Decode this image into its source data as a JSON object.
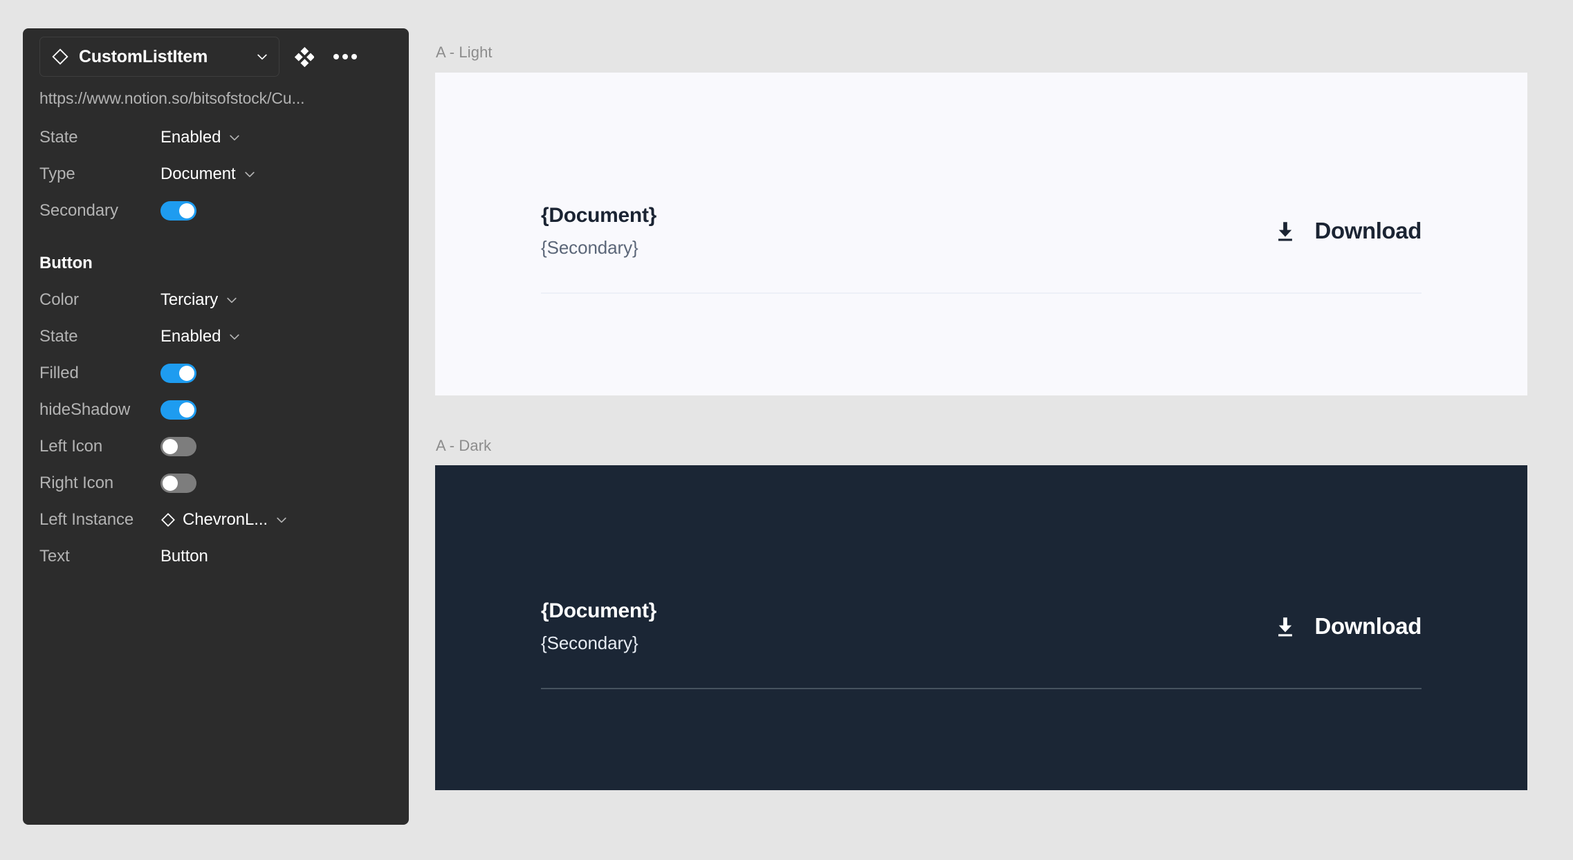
{
  "panel": {
    "component_name": "CustomListItem",
    "url": "https://www.notion.so/bitsofstock/Cu...",
    "icons": {
      "component": "diamond-icon",
      "dropdown": "chevron-down-icon",
      "swap": "four-diamond-icon",
      "more": "more-options-icon"
    },
    "properties": [
      {
        "label": "State",
        "type": "select",
        "value": "Enabled"
      },
      {
        "label": "Type",
        "type": "select",
        "value": "Document"
      },
      {
        "label": "Secondary",
        "type": "toggle",
        "value": "on"
      }
    ],
    "button_section": {
      "title": "Button",
      "properties": [
        {
          "label": "Color",
          "type": "select",
          "value": "Terciary"
        },
        {
          "label": "State",
          "type": "select",
          "value": "Enabled"
        },
        {
          "label": "Filled",
          "type": "toggle",
          "value": "on"
        },
        {
          "label": "hideShadow",
          "type": "toggle",
          "value": "on"
        },
        {
          "label": "Left Icon",
          "type": "toggle",
          "value": "off"
        },
        {
          "label": "Right Icon",
          "type": "toggle",
          "value": "off"
        },
        {
          "label": "Left Instance",
          "type": "instance",
          "value": "ChevronL..."
        },
        {
          "label": "Text",
          "type": "text",
          "value": "Button"
        }
      ]
    }
  },
  "canvas": {
    "frames": [
      {
        "label": "A - Light",
        "theme": "light",
        "background": "#f9f9fd",
        "title": "{Document}",
        "subtitle": "{Secondary}",
        "button_label": "Download",
        "button_icon": "download-icon"
      },
      {
        "label": "A - Dark",
        "theme": "dark",
        "background": "#1b2635",
        "title": "{Document}",
        "subtitle": "{Secondary}",
        "button_label": "Download",
        "button_icon": "download-icon"
      }
    ]
  },
  "colors": {
    "canvas_background": "#e5e5e5",
    "panel_background": "#2c2c2c",
    "toggle_on": "#1e9cf0",
    "toggle_off": "#7d7d7d",
    "light_card": "#f9f9fd",
    "dark_card": "#1b2635"
  }
}
